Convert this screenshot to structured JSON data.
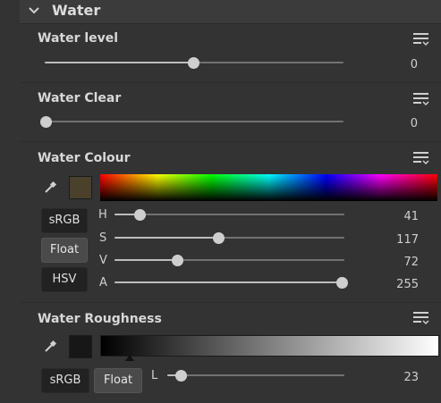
{
  "panel": {
    "title": "Water"
  },
  "sections": {
    "water_level": {
      "title": "Water level",
      "value": "0",
      "slider_fraction": 0.5
    },
    "water_clear": {
      "title": "Water Clear",
      "value": "0",
      "slider_fraction": 0.0
    },
    "water_colour": {
      "title": "Water Colour",
      "swatch_color": "#4a412c",
      "buttons": {
        "srgb": "sRGB",
        "float": "Float",
        "hsv": "HSV"
      },
      "channels": {
        "h": {
          "label": "H",
          "value": "41",
          "fraction": 0.11
        },
        "s": {
          "label": "S",
          "value": "117",
          "fraction": 0.46
        },
        "v": {
          "label": "V",
          "value": "72",
          "fraction": 0.28
        },
        "a": {
          "label": "A",
          "value": "255",
          "fraction": 1.0
        }
      }
    },
    "water_roughness": {
      "title": "Water Roughness",
      "swatch_color": "#171717",
      "buttons": {
        "srgb": "sRGB",
        "float": "Float"
      },
      "channel": {
        "label": "L",
        "value": "23",
        "fraction": 0.09
      }
    }
  },
  "icons": {
    "collapse": "chevron-down-icon",
    "menu": "menu-icon",
    "eyedropper": "eyedropper-icon"
  }
}
